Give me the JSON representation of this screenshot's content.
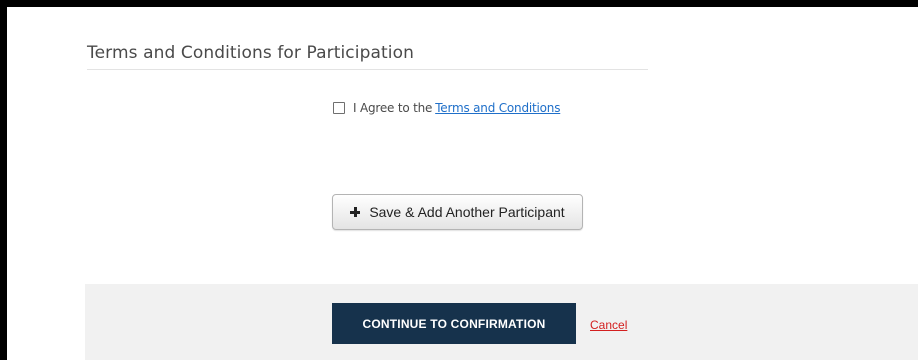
{
  "section": {
    "title": "Terms and Conditions for Participation"
  },
  "agreement": {
    "checked": false,
    "label_prefix": "I Agree to the",
    "link_text": "Terms and Conditions"
  },
  "actions": {
    "save_add_icon": "plus-icon",
    "save_add_label": "Save & Add Another Participant",
    "continue_label": "CONTINUE TO CONFIRMATION",
    "cancel_label": "Cancel"
  },
  "colors": {
    "primary_button": "#16324c",
    "link": "#1f6fc9",
    "cancel": "#d31f1f",
    "footer_bg": "#f1f1f1"
  }
}
